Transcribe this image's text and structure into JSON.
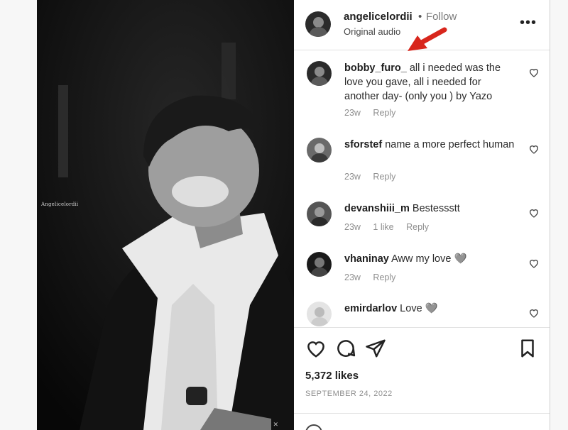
{
  "media": {
    "watermark": "Angelicelordii",
    "corner_mark": "✕"
  },
  "header": {
    "username": "angelicelordii",
    "separator": "•",
    "follow_label": "Follow",
    "audio_label": "Original audio",
    "more_icon": "•••"
  },
  "comments": [
    {
      "username": "bobby_furo_",
      "text": " all i needed was the love you gave, all i needed for another day- (only you ) by Yazo",
      "time": "23w",
      "likes": "",
      "reply": "Reply"
    },
    {
      "username": "sforstef",
      "text": " name a more perfect human",
      "time": "23w",
      "likes": "",
      "reply": "Reply"
    },
    {
      "username": "devanshiii_m",
      "text": " Bestessstt",
      "time": "23w",
      "likes": "1 like",
      "reply": "Reply"
    },
    {
      "username": "vhaninay",
      "text": " Aww my love 🩶",
      "time": "23w",
      "likes": "",
      "reply": "Reply"
    },
    {
      "username": "emirdarlov",
      "text": " Love 🩶",
      "time": "",
      "likes": "",
      "reply": ""
    }
  ],
  "footer": {
    "likes_count": "5,372 likes",
    "date": "SEPTEMBER 24, 2022"
  },
  "colors": {
    "arrow": "#d8261c",
    "text": "#1e1e1e",
    "muted": "#8e8e8e"
  }
}
